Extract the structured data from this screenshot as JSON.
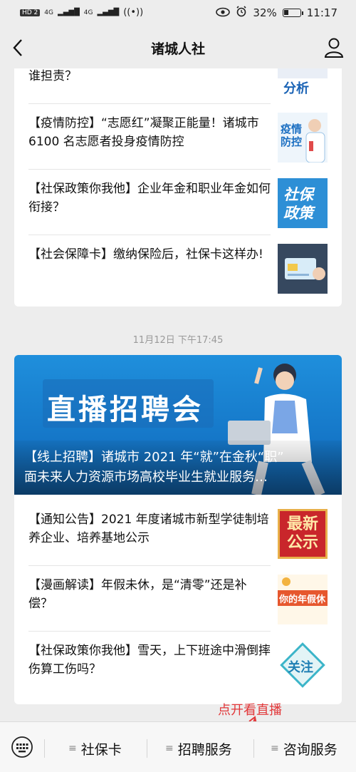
{
  "status_bar": {
    "left_labels": [
      "HD 2",
      "4G",
      "4G"
    ],
    "battery": "32%",
    "battery_level": 0.32,
    "time": "11:17"
  },
  "nav": {
    "title": "诸城人社"
  },
  "card1": {
    "items": [
      {
        "text": "【某某分析】关于加班工作，劳动者受伤工伤谁担责？",
        "thumb": "分析"
      },
      {
        "text": "【疫情防控】“志愿红”凝聚正能量！诸城市 6100 名志愿者投身疫情防控",
        "thumb": "疫情防控"
      },
      {
        "text": "【社保政策你我他】企业年金和职业年金如何衔接？",
        "thumb": "社保政策"
      },
      {
        "text": "【社会保障卡】缴纳保险后，社保卡这样办!",
        "thumb": ""
      }
    ]
  },
  "timestamp": "11月12日 下午17:45",
  "card2": {
    "banner": {
      "headline": "直播招聘会",
      "caption_line1": "【线上招聘】诸城市 2021 年“就”在金秋“职”",
      "caption_line2": "面未来人力资源市场高校毕业生就业服务…"
    },
    "items": [
      {
        "text": "【通知公告】2021 年度诸城市新型学徒制培养企业、培养基地公示",
        "thumb": "最新公示"
      },
      {
        "text": "【漫画解读】年假未休，是“清零”还是补偿？",
        "thumb": "你的年假休"
      },
      {
        "text": "【社保政策你我他】雪天，上下班途中滑倒摔伤算工伤吗？",
        "thumb": "关注"
      }
    ]
  },
  "annotation": "点开看直播",
  "tabbar": {
    "tabs": [
      {
        "label": "社保卡"
      },
      {
        "label": "招聘服务"
      },
      {
        "label": "咨询服务"
      }
    ]
  },
  "colors": {
    "banner_blue": "#1577c8",
    "annotation_red": "#e2383a"
  }
}
